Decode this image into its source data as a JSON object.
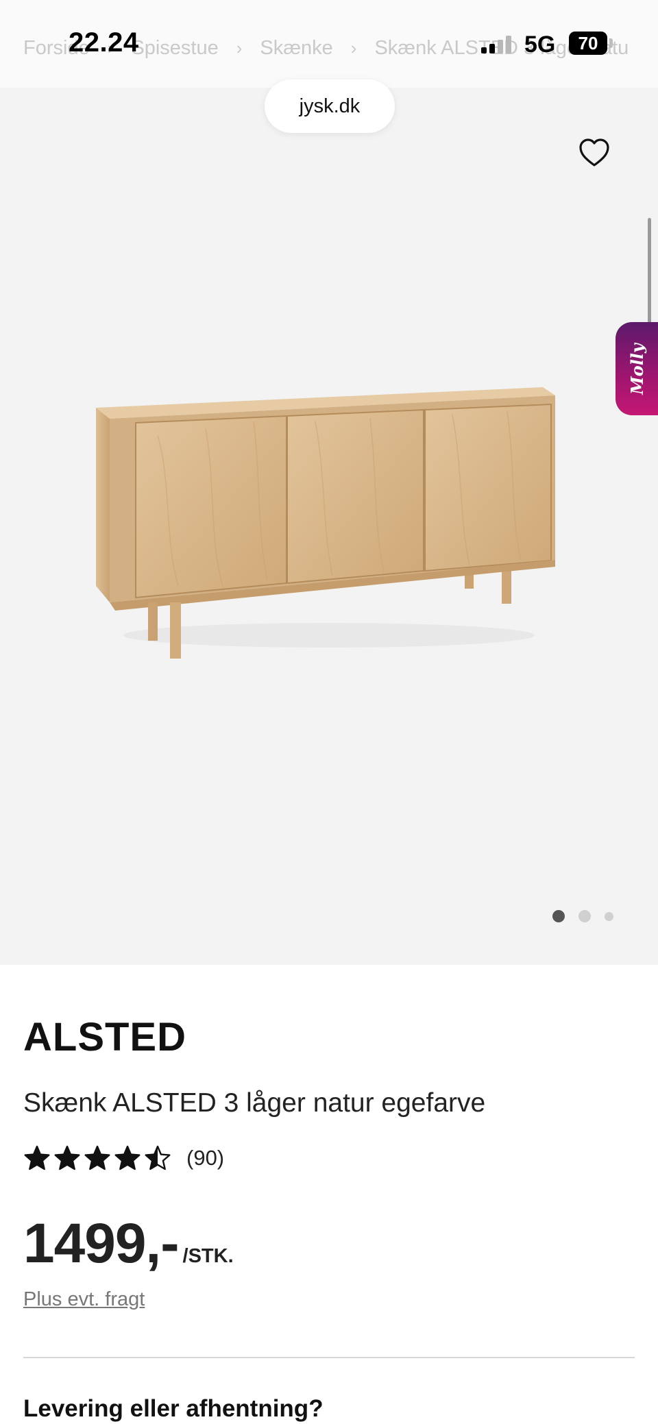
{
  "status_bar": {
    "time": "22.24",
    "network": "5G",
    "battery": "70"
  },
  "breadcrumb": {
    "items": [
      "Forside",
      "Spisestue",
      "Skænke",
      "Skænk ALSTED 3 låger natu"
    ]
  },
  "browser": {
    "url": "jysk.dk"
  },
  "gallery": {
    "image_count": 3,
    "active_index": 0,
    "wishlist_icon": "heart-outline-icon",
    "chat_widget_label": "Molly"
  },
  "product": {
    "brand": "ALSTED",
    "name": "Skænk ALSTED 3 låger natur egefarve",
    "rating_value": 4.5,
    "rating_max": 5,
    "review_count": "(90)",
    "price": "1499,-",
    "price_unit": "/STK.",
    "shipping_note": "Plus evt. fragt"
  },
  "delivery": {
    "heading": "Levering eller afhentning?"
  },
  "colors": {
    "gallery_background": "#f3f3f4",
    "text_primary": "#111111",
    "molly_gradient_start": "#5c1a6b",
    "molly_gradient_end": "#c41873",
    "wood": "#d9b98d"
  }
}
